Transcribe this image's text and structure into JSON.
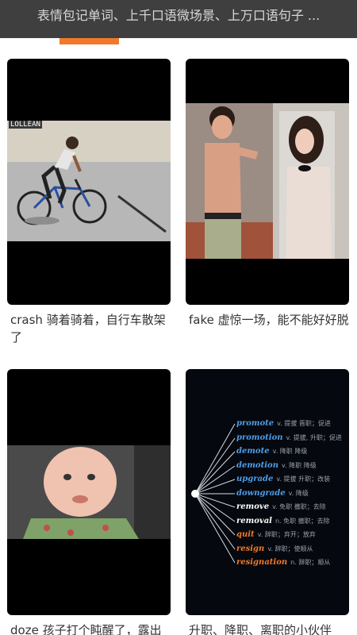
{
  "header": {
    "title": "表情包记单词、上千口语微场景、上万口语句子 ..."
  },
  "colors": {
    "accent": "#f07a2a",
    "topbar": "#3f3f3f"
  },
  "cards": [
    {
      "caption": "crash 骑着骑着，自行车散架了",
      "sign_text": "LOLLEAN"
    },
    {
      "caption": "fake 虚惊一场，能不能好好脱"
    },
    {
      "caption": "doze 孩子打个盹醒了，露出"
    },
    {
      "caption": "升职、降职、离职的小伙伴",
      "mindmap": [
        {
          "word": "promote",
          "def": "v. 提拔 晋职；促进",
          "color": "#4f9ee8"
        },
        {
          "word": "promotion",
          "def": "v. 提拔, 升职；促进",
          "color": "#4f9ee8"
        },
        {
          "word": "demote",
          "def": "v. 降职 降级",
          "color": "#4f9ee8"
        },
        {
          "word": "demotion",
          "def": "v. 降职 降级",
          "color": "#4f9ee8"
        },
        {
          "word": "upgrade",
          "def": "v. 提拔 升职；改装",
          "color": "#4f9ee8"
        },
        {
          "word": "downgrade",
          "def": "v. 降级",
          "color": "#4f9ee8"
        },
        {
          "word": "remove",
          "def": "v. 免职 撤职；去除",
          "color": "#ffffff"
        },
        {
          "word": "removal",
          "def": "n. 免职 撤职；去除",
          "color": "#ffffff"
        },
        {
          "word": "quit",
          "def": "v. 辞职；弃开；放弃",
          "color": "#f07a2a"
        },
        {
          "word": "resign",
          "def": "v. 辞职；使顺从",
          "color": "#f07a2a"
        },
        {
          "word": "resignation",
          "def": "n. 辞职；顺从",
          "color": "#f07a2a"
        }
      ]
    }
  ]
}
